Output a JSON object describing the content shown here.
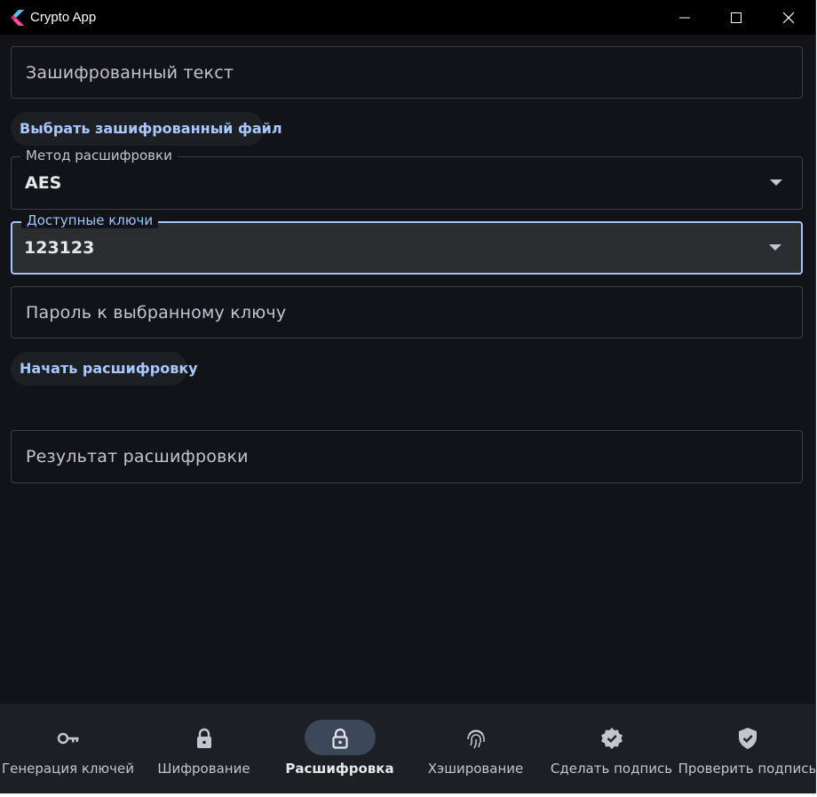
{
  "window": {
    "title": "Crypto App"
  },
  "form": {
    "encrypted_text_placeholder": "Зашифрованный текст",
    "choose_file_button": "Выбрать зашифрованный файл",
    "method": {
      "label": "Метод расшифровки",
      "value": "AES"
    },
    "keys": {
      "label": "Доступные ключи",
      "value": "123123"
    },
    "password_placeholder": "Пароль к выбранному ключу",
    "start_button": "Начать расшифровку",
    "result_placeholder": "Результат расшифровки"
  },
  "nav": {
    "items": [
      {
        "label": "Генерация ключей",
        "icon": "key-icon",
        "active": false
      },
      {
        "label": "Шифрование",
        "icon": "lock-icon",
        "active": false
      },
      {
        "label": "Расшифровка",
        "icon": "unlock-icon",
        "active": true
      },
      {
        "label": "Хэширование",
        "icon": "fingerprint-icon",
        "active": false
      },
      {
        "label": "Сделать подпись",
        "icon": "verified-badge-icon",
        "active": false
      },
      {
        "label": "Проверить подпись",
        "icon": "shield-check-icon",
        "active": false
      }
    ]
  },
  "colors": {
    "accent": "#9ec7ff",
    "button_text": "#a8c8ff",
    "background": "#111318",
    "nav_background": "#1c1f24",
    "active_pill": "#3c4859"
  }
}
